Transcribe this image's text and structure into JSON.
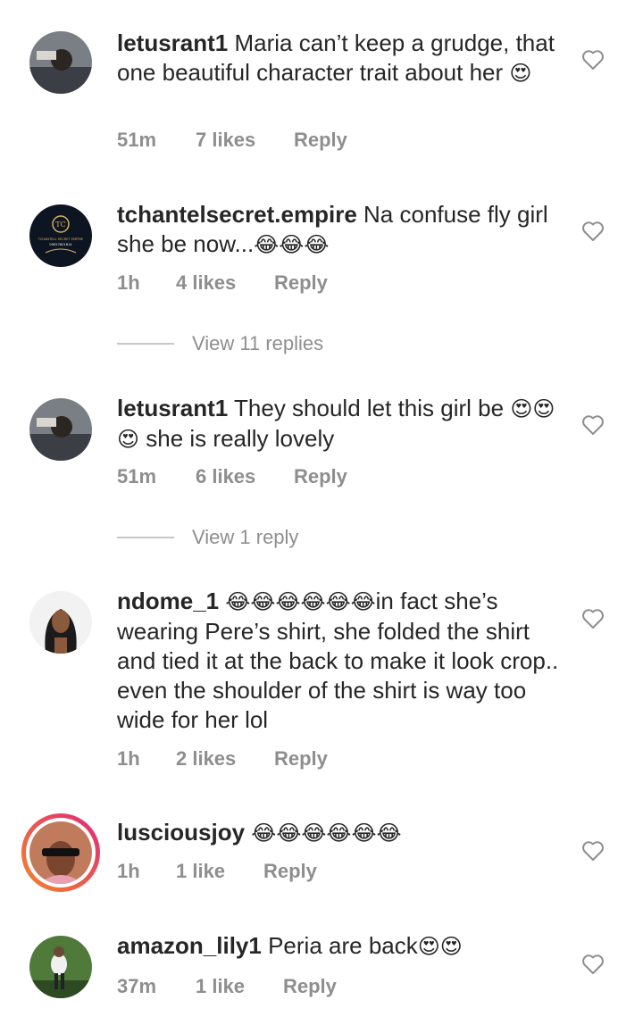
{
  "comments": [
    {
      "username": "letusrant1",
      "text": "Maria can’t keep a grudge, that one beautiful character trait about her",
      "emoji": "😍",
      "time": "51m",
      "likes": "7 likes",
      "reply": "Reply"
    },
    {
      "username": "tchantelsecret.empire",
      "text": "Na confuse fly girl she be now...",
      "emoji": "😂😂😂",
      "time": "1h",
      "likes": "4 likes",
      "reply": "Reply",
      "avatar_text": "TCHANTELL SECRET EMPIRE",
      "avatar_phone": "09057621614",
      "avatar_initials": "TC"
    },
    {
      "username": "letusrant1",
      "text": "They should let this girl be",
      "emoji": "😍😍😍",
      "text2": "she is really lovely",
      "time": "51m",
      "likes": "6 likes",
      "reply": "Reply"
    },
    {
      "username": "ndome_1",
      "emoji": "😂😂😂😂😂😂",
      "text": "in fact she’s wearing Pere’s shirt, she folded the shirt and tied it at the back to make it look crop.. even the shoulder of the shirt is way too wide for her lol",
      "time": "1h",
      "likes": "2 likes",
      "reply": "Reply"
    },
    {
      "username": "lusciousjoy",
      "emoji": "😂😂😂😂😂😂",
      "time": "1h",
      "likes": "1 like",
      "reply": "Reply"
    },
    {
      "username": "amazon_lily1",
      "text": "Peria are back",
      "emoji": "😍😍",
      "time": "37m",
      "likes": "1 like",
      "reply": "Reply"
    }
  ],
  "view_replies": [
    "View 11 replies",
    "View 1 reply"
  ],
  "colors": {
    "text": "#262626",
    "meta": "#8e8e8e",
    "story_ring_start": "#f58529",
    "story_ring_end": "#dd2a7b"
  }
}
